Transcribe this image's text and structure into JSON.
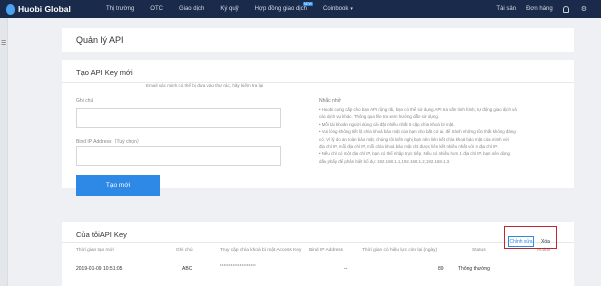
{
  "brand": {
    "name": "Huobi Global"
  },
  "nav": {
    "items": [
      "Thị trường",
      "OTC",
      "Giao dịch",
      "Ký quỹ",
      "Hợp đồng giao dịch",
      "Coinbook"
    ],
    "new_badge": "NEW",
    "assets": "Tài sản",
    "orders": "Đơn hàng"
  },
  "page": {
    "title": "Quản lý API"
  },
  "create": {
    "title": "Tạo API Key mới",
    "note_label": "Ghi chú",
    "ip_label": "Bind IP Address（Tuỳ chọn）",
    "ip_hint": "Email xác minh có thể bị đưa vào thư rác, hãy kiểm tra lại",
    "button": "Tạo mới"
  },
  "notes": {
    "title": "Nhắc nhở",
    "lines": [
      "• Huobi cung cấp cho bạn API rộng rãi, bạn có thể sử dụng API tra vấn tình hình, tự động giao dịch và",
      "các dịch vụ khác. Thông qua file tra xem hướng dẫn sử dụng.",
      "• Mỗi tài khoản người dùng cài đặt nhiều nhất 5 cặp chìa khoá bí mật.",
      "• Vui lòng không tiết lộ chìa khoá bảo mật của bạn cho bất cứ ai, để tránh những tổn thất không đáng",
      "có. Vì lý do an toàn bảo mật, chúng tôi kiến nghị bạn nên liên kết chìa khoá bảo mật của mình với",
      "địa chỉ IP, mỗi địa chỉ IP, mỗi chìa khoá bảo mật chỉ được liên kết nhiều nhất với 4 địa chỉ IP.",
      "• Nếu chỉ có một địa chỉ IP, bạn có thể nhập trực tiếp. Nếu có nhiều hơn 1 địa chỉ IP, bạn nên dùng",
      "dấu phẩy để phân biệt bổ dụ: 192.168.1.1,192.168.1.2,192.168.1.3."
    ]
  },
  "apikeys": {
    "title": "Của tôiAPI Key",
    "headers": {
      "created": "Thời gian tạo mới",
      "note": "Ghi chú",
      "access_key": "Truy cập chìa khoá bí mật Access Key",
      "bind_ip": "Bind IP Address",
      "remaining": "Thời gian có hiệu lực còn lại (ngày)",
      "status": "Status",
      "action": "Action"
    },
    "row": {
      "created": "2019-01-09 10:51:05",
      "note": "ABC",
      "access_key_masked": "••••••••••••••••••••",
      "bind_ip": "--",
      "remaining": "89",
      "status": "Thông thường",
      "edit": "Chỉnh sửa",
      "delete": "Xóa"
    }
  },
  "colors": {
    "nav_bg": "#1a2a4a",
    "accent": "#2e88e6",
    "highlight_box": "#c0282e"
  }
}
